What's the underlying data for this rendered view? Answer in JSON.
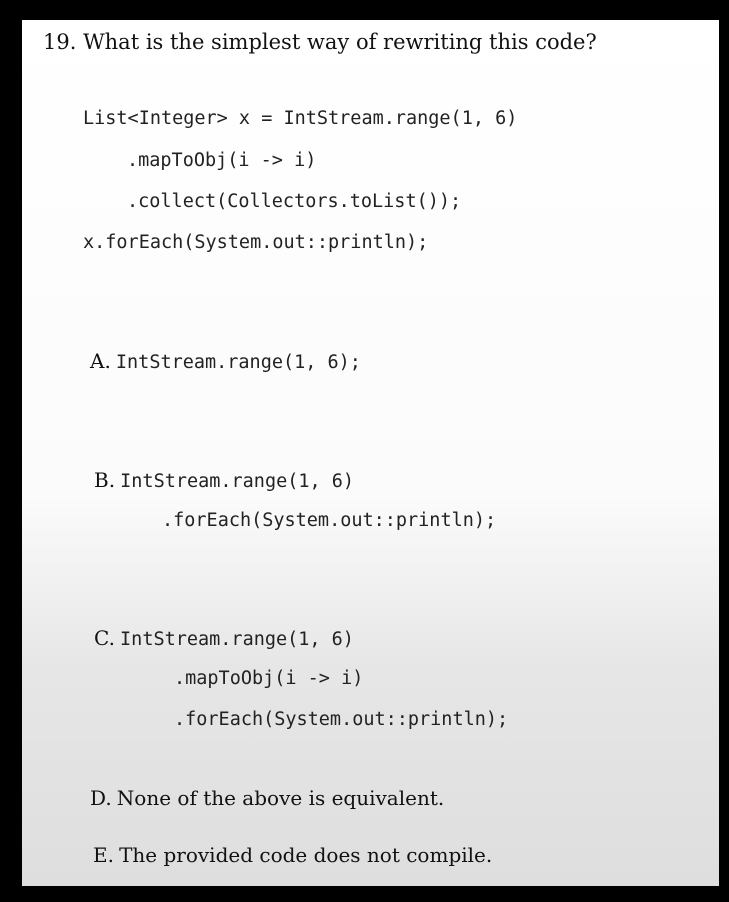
{
  "question": {
    "text": "19. What is the simplest way of rewriting this code?",
    "code_lines": [
      "List<Integer> x = IntStream.range(1, 6)",
      ".mapToObj(i -> i)",
      ".collect(Collectors.toList());",
      "x.forEach(System.out::println);"
    ]
  },
  "options": [
    {
      "letter": "A.",
      "lines": [
        "IntStream.range(1, 6);"
      ]
    },
    {
      "letter": "B.",
      "lines": [
        "IntStream.range(1, 6)",
        ".forEach(System.out::println);"
      ]
    },
    {
      "letter": "C.",
      "lines": [
        "IntStream.range(1, 6)",
        ".mapToObj(i -> i)",
        ".forEach(System.out::println);"
      ]
    },
    {
      "letter": "D.",
      "text": "None of the above is equivalent."
    },
    {
      "letter": "E.",
      "text": "The provided code does not compile."
    }
  ]
}
